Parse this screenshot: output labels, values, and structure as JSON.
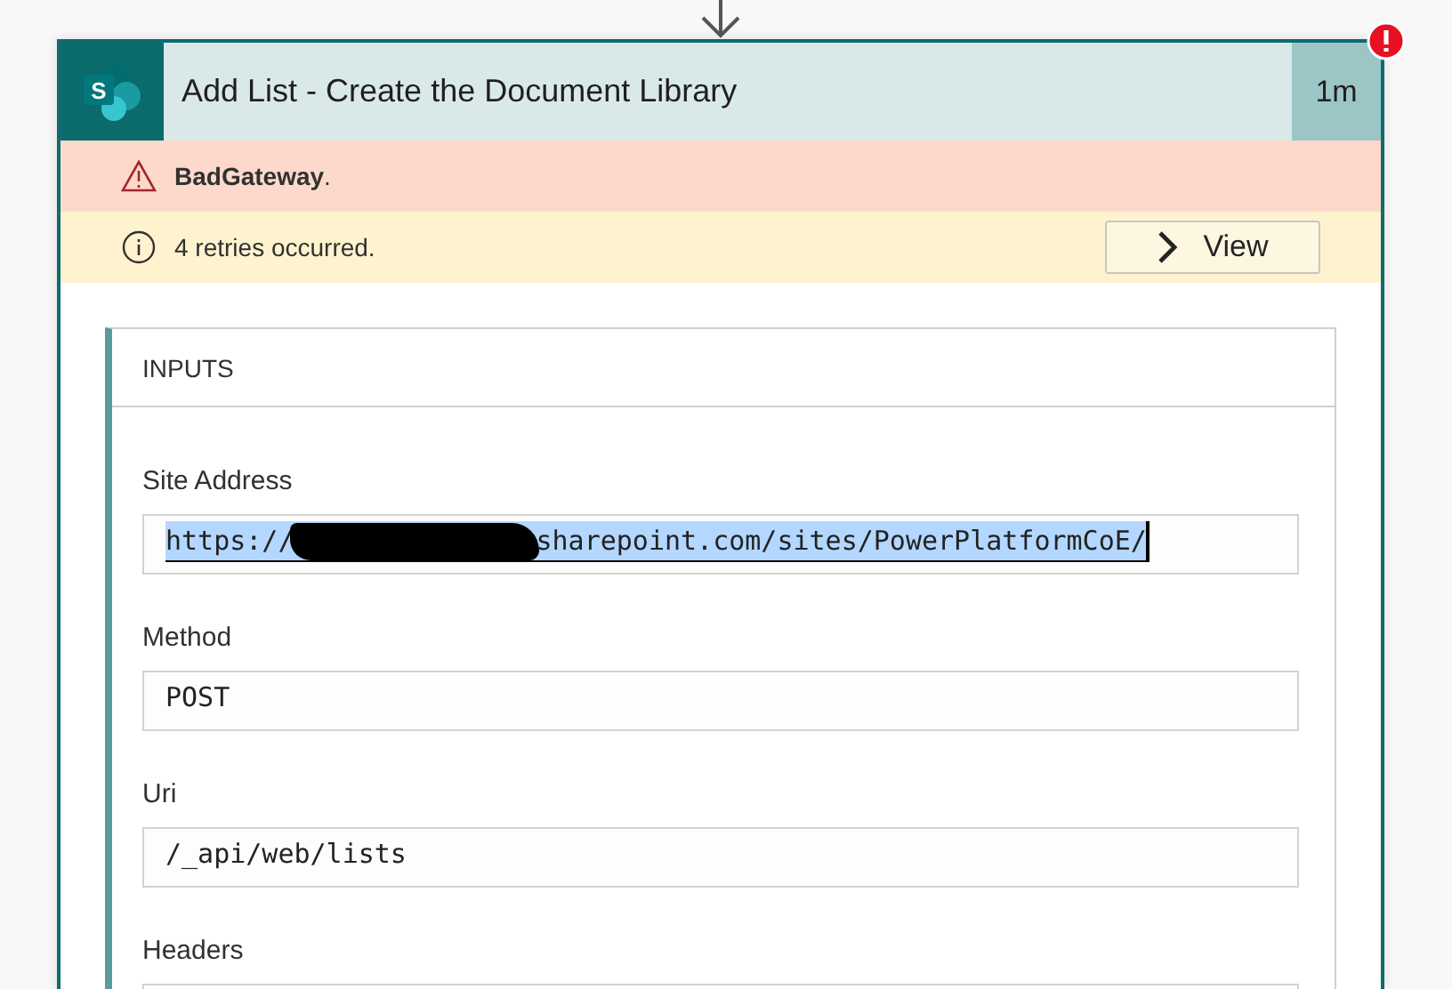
{
  "card": {
    "logo_letter": "S",
    "title": "Add List - Create the Document Library",
    "duration": "1m",
    "has_error": true
  },
  "error_bar": {
    "message": "**BadGateway**."
  },
  "retry_bar": {
    "message": "4 retries occurred.",
    "button": "View"
  },
  "inputs": {
    "heading": "INPUTS",
    "fields": [
      {
        "label": "Site Address",
        "selected": true,
        "segments": [
          {
            "kind": "text",
            "text": "https://"
          },
          {
            "kind": "redaction"
          },
          {
            "kind": "text",
            "text": "sharepoint.com/sites/PowerPlatformCoE/"
          }
        ]
      },
      {
        "label": "Method",
        "selected": false,
        "segments": [
          {
            "kind": "text",
            "text": "POST"
          }
        ]
      },
      {
        "label": "Uri",
        "selected": false,
        "segments": [
          {
            "kind": "text",
            "text": "/_api/web/lists"
          }
        ]
      },
      {
        "label": "Headers",
        "selected": false
      }
    ]
  }
}
